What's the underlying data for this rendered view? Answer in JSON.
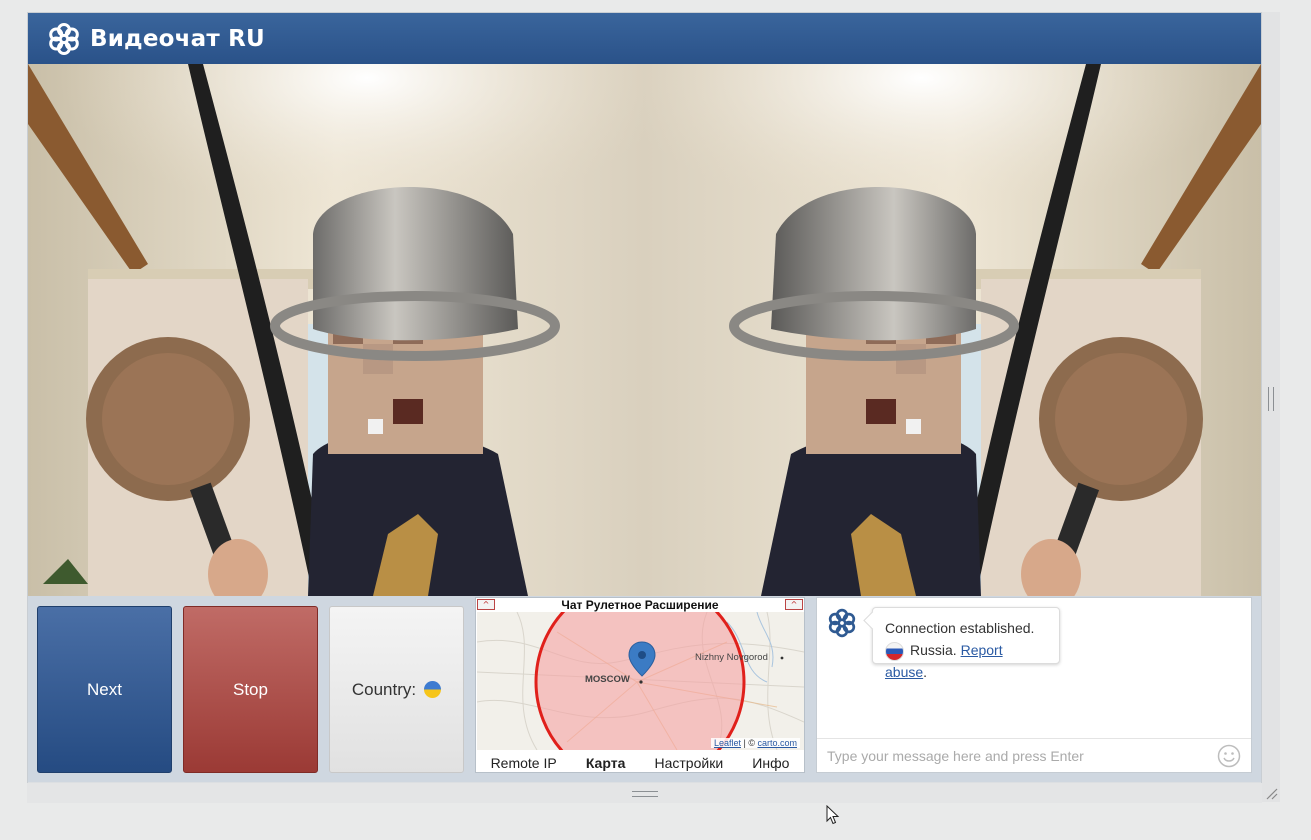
{
  "app": {
    "title": "Видеочат RU"
  },
  "controls": {
    "next_label": "Next",
    "stop_label": "Stop",
    "country_label": "Country:",
    "country_flag": "ukraine-flag"
  },
  "extension": {
    "title": "Чат Рулетное Расширение",
    "min_left": "^",
    "min_right": "^",
    "map": {
      "city_main": "MOSCOW",
      "city_other": "Nizhny Novgorod",
      "attribution_leaflet": "Leaflet",
      "attribution_sep": " | © ",
      "attribution_carto": "carto.com"
    },
    "tabs": [
      {
        "label": "Remote IP"
      },
      {
        "label": "Карта"
      },
      {
        "label": "Настройки"
      },
      {
        "label": "Инфо"
      }
    ],
    "active_tab": "Карта"
  },
  "chat": {
    "message_line1": "Connection established.",
    "country": "Russia.",
    "report_link": "Report abuse",
    "report_suffix": ".",
    "input_placeholder": "Type your message here and press Enter"
  },
  "colors": {
    "header": "#2f5a92",
    "next": "#2e5489",
    "stop": "#a9443f",
    "accent_link": "#2a5aa3"
  }
}
